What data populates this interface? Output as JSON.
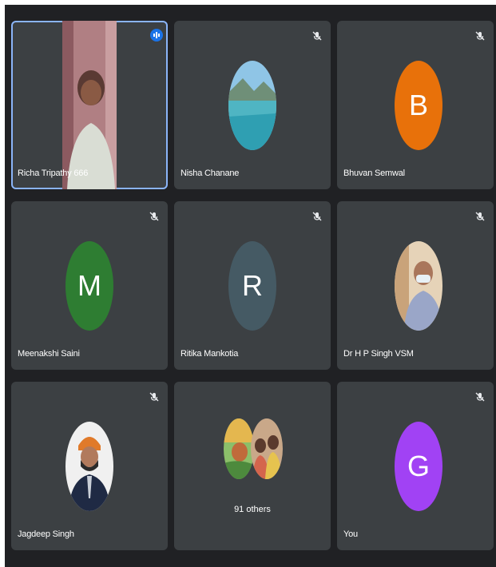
{
  "participants": [
    {
      "name": "Richa Tripathy 666",
      "type": "video",
      "speaking": true
    },
    {
      "name": "Nisha Chanane",
      "type": "photo",
      "photo": "landscape lake mountain",
      "muted": true
    },
    {
      "name": "Bhuvan Semwal",
      "type": "initial",
      "initial": "B",
      "color": "#e8710a",
      "muted": true
    },
    {
      "name": "Meenakshi Saini",
      "type": "initial",
      "initial": "M",
      "color": "#2e7d32",
      "muted": true
    },
    {
      "name": "Ritika Mankotia",
      "type": "initial",
      "initial": "R",
      "color": "#455a64",
      "muted": true
    },
    {
      "name": "Dr H P Singh VSM",
      "type": "photo",
      "photo": "man with mask",
      "muted": true
    },
    {
      "name": "Jagdeep Singh",
      "type": "photo",
      "photo": "man in turban and suit",
      "muted": true
    },
    {
      "name": "91 others",
      "type": "others"
    },
    {
      "name": "You",
      "type": "initial",
      "initial": "G",
      "color": "#a142f4",
      "muted": true
    }
  ],
  "colors": {
    "background": "#202124",
    "tile": "#3c4043",
    "active_border": "#8ab4f8",
    "speaking_badge": "#1a73e8"
  },
  "icons": {
    "muted": "mic-off-icon",
    "speaking": "speaking-indicator-icon"
  }
}
